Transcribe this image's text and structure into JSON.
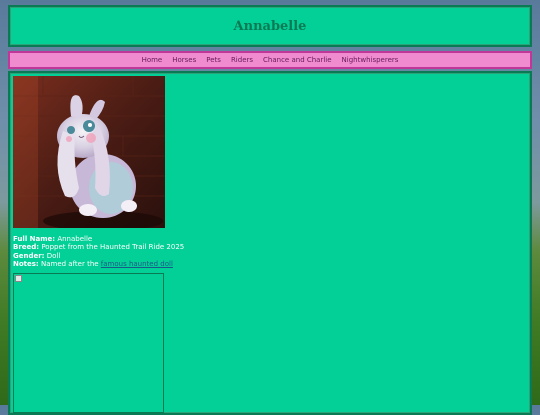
{
  "header": {
    "title": "Annabelle"
  },
  "nav": {
    "items": [
      "Home",
      "Horses",
      "Pets",
      "Riders",
      "Chance and Charlie",
      "Nightwhisperers"
    ]
  },
  "profile": {
    "image_icon": "bunny-pet-photo",
    "full_name_label": "Full Name:",
    "full_name": "Annabelle",
    "breed_label": "Breed:",
    "breed": "Poppet from the Haunted Trail Ride 2025",
    "gender_label": "Gender:",
    "gender": "Doll",
    "notes_label": "Notes:",
    "notes_text": "Named after the",
    "notes_link": "famous haunted doll"
  },
  "colors": {
    "panel": "#03d096",
    "nav": "#f08bd0",
    "title": "#0a7a55"
  }
}
